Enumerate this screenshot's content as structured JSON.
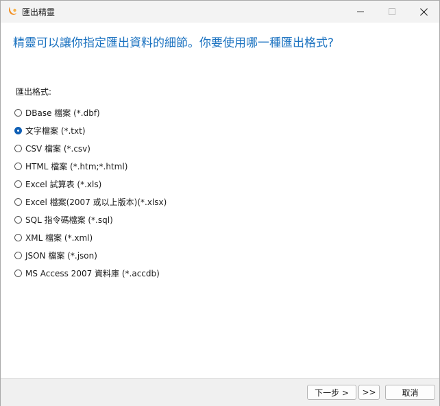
{
  "window": {
    "title": "匯出精靈",
    "accent_color": "#1b72c0",
    "icons": {
      "app": "navicat-app-icon",
      "minimize": "minimize-icon",
      "maximize": "maximize-icon",
      "close": "close-icon"
    }
  },
  "main": {
    "heading": "精靈可以讓你指定匯出資料的細節。你要使用哪一種匯出格式?",
    "group_label": "匯出格式:",
    "selected_index": 1,
    "formats": [
      {
        "label": "DBase 檔案 (*.dbf)"
      },
      {
        "label": "文字檔案 (*.txt)"
      },
      {
        "label": "CSV 檔案 (*.csv)"
      },
      {
        "label": "HTML 檔案 (*.htm;*.html)"
      },
      {
        "label": "Excel 試算表 (*.xls)"
      },
      {
        "label": "Excel 檔案(2007 或以上版本)(*.xlsx)"
      },
      {
        "label": "SQL 指令碼檔案 (*.sql)"
      },
      {
        "label": "XML 檔案 (*.xml)"
      },
      {
        "label": "JSON 檔案 (*.json)"
      },
      {
        "label": "MS Access 2007 資料庫 (*.accdb)"
      }
    ]
  },
  "footer": {
    "next_label": "下一步 >",
    "finish_label": ">>",
    "cancel_label": "取消"
  }
}
